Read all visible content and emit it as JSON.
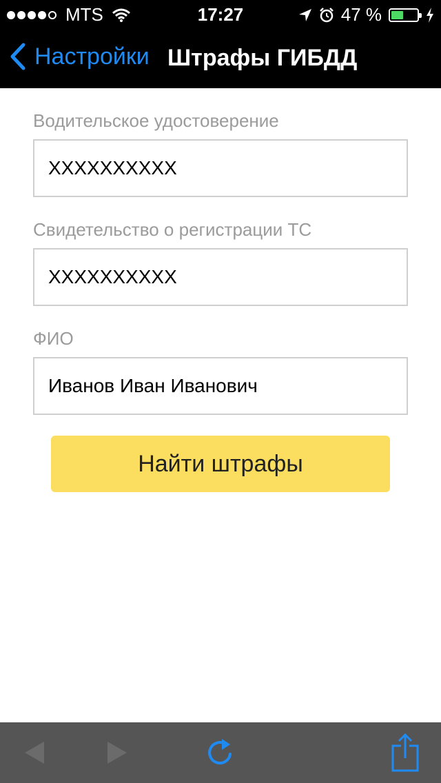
{
  "status_bar": {
    "carrier": "MTS",
    "time": "17:27",
    "battery_percent": "47 %",
    "battery_level": 0.47,
    "signal_bars_filled": 4,
    "signal_bars_total": 5
  },
  "nav": {
    "back_label": "Настройки",
    "title": "Штрафы ГИБДД"
  },
  "form": {
    "license_label": "Водительское удостоверение",
    "license_value": "XXXXXXXXXX",
    "registration_label": "Свидетельство о регистрации ТС",
    "registration_value": "XXXXXXXXXX",
    "name_label": "ФИО",
    "name_value": "Иванов Иван Иванович",
    "submit_label": "Найти штрафы"
  },
  "colors": {
    "accent": "#1f8bf2",
    "button": "#fbdd5f",
    "toolbar": "#555555",
    "battery": "#4cd964"
  },
  "toolbar": {
    "icons": [
      "back-arrow-icon",
      "forward-arrow-icon",
      "reload-icon",
      "share-icon"
    ]
  }
}
